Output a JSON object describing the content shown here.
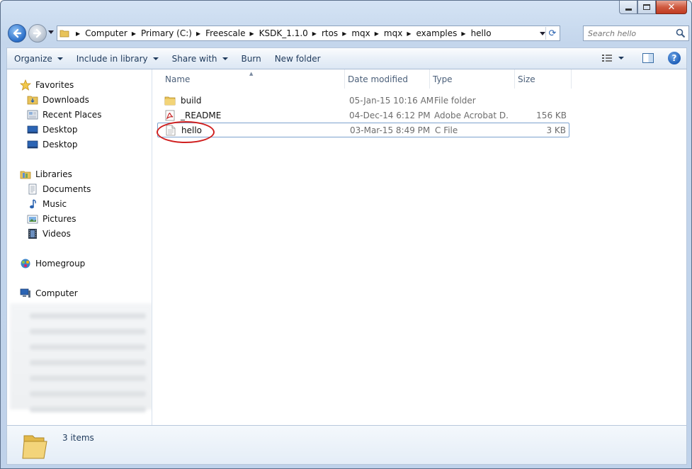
{
  "window": {
    "caption": {
      "minimize_icon": "minimize-icon",
      "maximize_icon": "maximize-icon",
      "close_icon": "close-icon"
    }
  },
  "address": {
    "crumbs": [
      "Computer",
      "Primary (C:)",
      "Freescale",
      "KSDK_1.1.0",
      "rtos",
      "mqx",
      "mqx",
      "examples",
      "hello"
    ]
  },
  "search": {
    "placeholder": "Search hello"
  },
  "toolbar": {
    "organize": "Organize",
    "include_in_library": "Include in library",
    "share_with": "Share with",
    "burn": "Burn",
    "new_folder": "New folder"
  },
  "navigation": {
    "favorites": {
      "label": "Favorites",
      "items": [
        "Downloads",
        "Recent Places",
        "Desktop",
        "Desktop"
      ]
    },
    "libraries": {
      "label": "Libraries",
      "items": [
        "Documents",
        "Music",
        "Pictures",
        "Videos"
      ]
    },
    "homegroup": "Homegroup",
    "computer": "Computer"
  },
  "columns": {
    "name": "Name",
    "date": "Date modified",
    "type": "Type",
    "size": "Size"
  },
  "files": [
    {
      "name": "build",
      "date": "05-Jan-15 10:16 AM",
      "type": "File folder",
      "size": "",
      "icon": "folder-icon"
    },
    {
      "name": "_README",
      "date": "04-Dec-14 6:12 PM",
      "type": "Adobe Acrobat D...",
      "size": "156 KB",
      "icon": "pdf-icon"
    },
    {
      "name": "hello",
      "date": "03-Mar-15 8:49 PM",
      "type": "C File",
      "size": "3 KB",
      "icon": "text-file-icon"
    }
  ],
  "status": {
    "count": "3 items"
  },
  "colors": {
    "annotation": "#d02020",
    "selection_border": "#7da2ce"
  }
}
